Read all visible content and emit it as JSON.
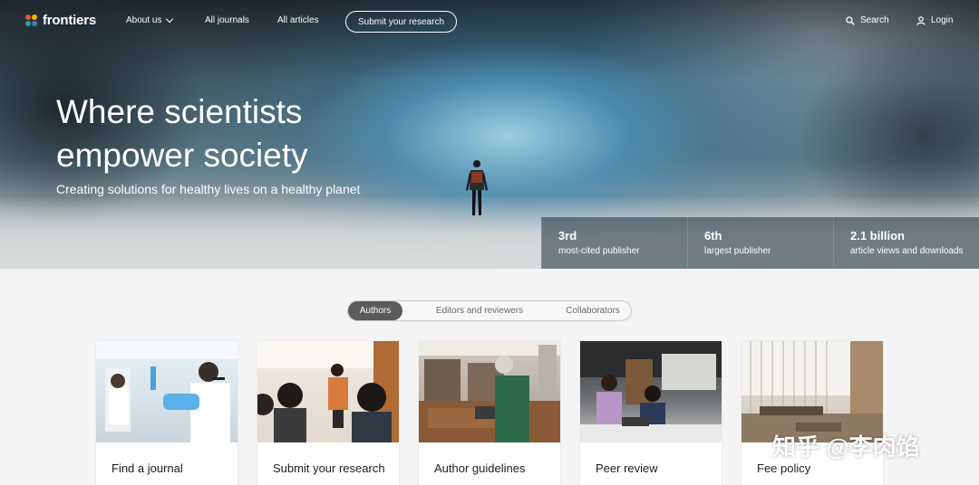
{
  "nav": {
    "logo_text": "frontiers",
    "about_label": "About us",
    "journals_label": "All journals",
    "articles_label": "All articles",
    "submit_label": "Submit your research",
    "search_label": "Search",
    "login_label": "Login"
  },
  "hero": {
    "title": "Where scientists empower society",
    "subtitle": "Creating solutions for healthy lives on a healthy planet"
  },
  "stats": [
    {
      "value": "3rd",
      "label": "most-cited publisher"
    },
    {
      "value": "6th",
      "label": "largest publisher"
    },
    {
      "value": "2.1 billion",
      "label": "article views and downloads"
    }
  ],
  "tabs": [
    {
      "label": "Authors",
      "active": true
    },
    {
      "label": "Editors and reviewers",
      "active": false
    },
    {
      "label": "Collaborators",
      "active": false
    }
  ],
  "cards": [
    {
      "label": "Find a journal"
    },
    {
      "label": "Submit your research"
    },
    {
      "label": "Author guidelines"
    },
    {
      "label": "Peer review"
    },
    {
      "label": "Fee policy"
    }
  ],
  "watermark": "知乎 @李肉馅",
  "colors": {
    "logo_dots": [
      "#e4572e",
      "#f2b705",
      "#2a9d8f",
      "#3e7cb1"
    ],
    "tab_active_bg": "#5b5b5b",
    "page_bg": "#f4f4f4"
  }
}
